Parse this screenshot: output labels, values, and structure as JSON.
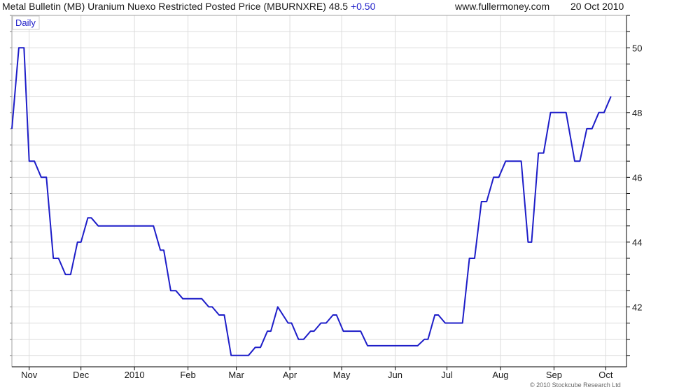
{
  "header": {
    "title": "Metal Bulletin (MB) Uranium Nuexo Restricted Posted Price (MBURNXRE) 48.5",
    "change": "+0.50",
    "site": "www.fullermoney.com",
    "date": "20 Oct 2010"
  },
  "footer": {
    "copyright": "© 2010 Stockcube Research Ltd"
  },
  "colors": {
    "line": "#1d1dc8",
    "grid": "#dcdcdc",
    "axis": "#000000",
    "text": "#1a1a1a"
  },
  "chart_data": {
    "type": "line",
    "badge": "Daily",
    "grid": true,
    "xlim": [
      0,
      356
    ],
    "ylim": [
      40.15,
      51.0
    ],
    "y_ticks": [
      42,
      44,
      46,
      48,
      50
    ],
    "x_ticks": [
      {
        "label": "Nov",
        "x": 10
      },
      {
        "label": "Dec",
        "x": 40
      },
      {
        "label": "2010",
        "x": 71
      },
      {
        "label": "Feb",
        "x": 102
      },
      {
        "label": "Mar",
        "x": 130
      },
      {
        "label": "Apr",
        "x": 161
      },
      {
        "label": "May",
        "x": 191
      },
      {
        "label": "Jun",
        "x": 222
      },
      {
        "label": "Jul",
        "x": 252
      },
      {
        "label": "Aug",
        "x": 283
      },
      {
        "label": "Sep",
        "x": 314
      },
      {
        "label": "Oct",
        "x": 344
      }
    ],
    "series": [
      {
        "values": [
          [
            0,
            47.5
          ],
          [
            4,
            50.0
          ],
          [
            7,
            50.0
          ],
          [
            10,
            46.5
          ],
          [
            13,
            46.5
          ],
          [
            17,
            46.0
          ],
          [
            20,
            46.0
          ],
          [
            24,
            43.5
          ],
          [
            27,
            43.5
          ],
          [
            31,
            43.0
          ],
          [
            34,
            43.0
          ],
          [
            38,
            44.0
          ],
          [
            40,
            44.0
          ],
          [
            44,
            44.75
          ],
          [
            46,
            44.75
          ],
          [
            50,
            44.5
          ],
          [
            75,
            44.5
          ],
          [
            82,
            44.5
          ],
          [
            86,
            43.75
          ],
          [
            88,
            43.75
          ],
          [
            92,
            42.5
          ],
          [
            95,
            42.5
          ],
          [
            99,
            42.25
          ],
          [
            110,
            42.25
          ],
          [
            114,
            42.0
          ],
          [
            116,
            42.0
          ],
          [
            120,
            41.75
          ],
          [
            123,
            41.75
          ],
          [
            127,
            40.5
          ],
          [
            137,
            40.5
          ],
          [
            141,
            40.75
          ],
          [
            144,
            40.75
          ],
          [
            148,
            41.25
          ],
          [
            150,
            41.25
          ],
          [
            154,
            42.0
          ],
          [
            160,
            41.5
          ],
          [
            162,
            41.5
          ],
          [
            166,
            41.0
          ],
          [
            169,
            41.0
          ],
          [
            173,
            41.25
          ],
          [
            175,
            41.25
          ],
          [
            179,
            41.5
          ],
          [
            182,
            41.5
          ],
          [
            186,
            41.75
          ],
          [
            188,
            41.75
          ],
          [
            192,
            41.25
          ],
          [
            202,
            41.25
          ],
          [
            206,
            40.8
          ],
          [
            235,
            40.8
          ],
          [
            239,
            41.0
          ],
          [
            241,
            41.0
          ],
          [
            245,
            41.75
          ],
          [
            247,
            41.75
          ],
          [
            251,
            41.5
          ],
          [
            261,
            41.5
          ],
          [
            265,
            43.5
          ],
          [
            268,
            43.5
          ],
          [
            272,
            45.25
          ],
          [
            275,
            45.25
          ],
          [
            279,
            46.0
          ],
          [
            282,
            46.0
          ],
          [
            286,
            46.5
          ],
          [
            295,
            46.5
          ],
          [
            299,
            44.0
          ],
          [
            301,
            44.0
          ],
          [
            305,
            46.75
          ],
          [
            308,
            46.75
          ],
          [
            312,
            48.0
          ],
          [
            321,
            48.0
          ],
          [
            326,
            46.5
          ],
          [
            329,
            46.5
          ],
          [
            333,
            47.5
          ],
          [
            336,
            47.5
          ],
          [
            340,
            48.0
          ],
          [
            343,
            48.0
          ],
          [
            347,
            48.5
          ]
        ]
      }
    ]
  }
}
